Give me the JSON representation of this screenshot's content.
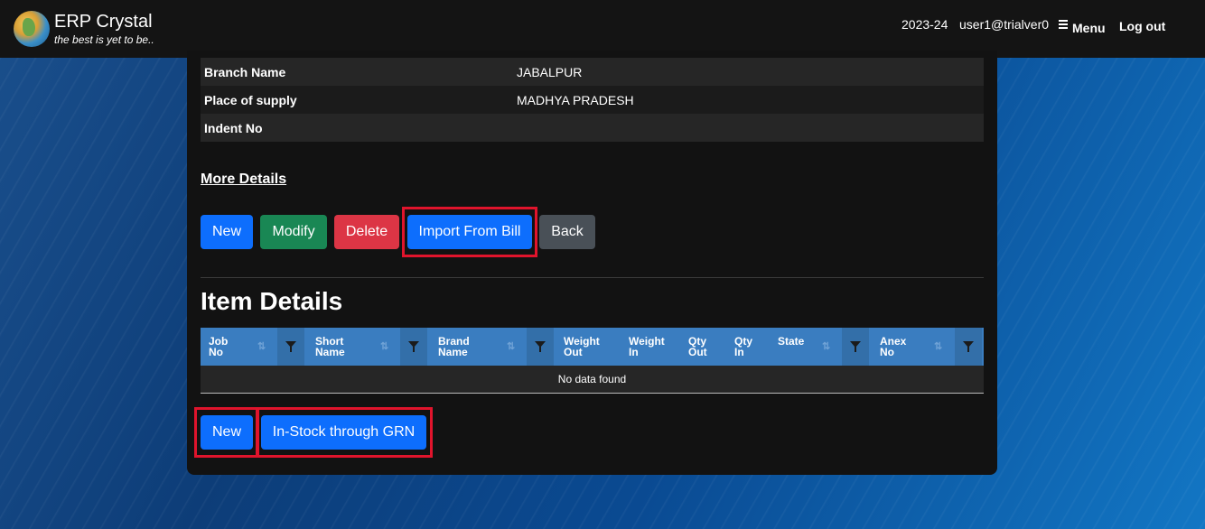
{
  "app": {
    "title": "ERP Crystal",
    "tagline": "the best is yet to be..",
    "year": "2023-24",
    "user": "user1@trialver0",
    "menu_label": "Menu",
    "logout_label": "Log out"
  },
  "info_rows": [
    {
      "label": "Branch Name",
      "value": "JABALPUR"
    },
    {
      "label": "Place of supply",
      "value": "MADHYA PRADESH"
    },
    {
      "label": "Indent No",
      "value": ""
    }
  ],
  "more_details_label": "More Details",
  "actions": {
    "new": "New",
    "modify": "Modify",
    "delete": "Delete",
    "import": "Import From Bill",
    "back": "Back"
  },
  "item_details": {
    "title": "Item Details",
    "columns": [
      {
        "line1": "Job",
        "line2": "No"
      },
      {
        "line1": "Short",
        "line2": "Name"
      },
      {
        "line1": "Brand",
        "line2": "Name"
      },
      {
        "line1": "Weight",
        "line2": "Out"
      },
      {
        "line1": "Weight",
        "line2": "In"
      },
      {
        "line1": "Qty",
        "line2": "Out"
      },
      {
        "line1": "Qty",
        "line2": "In"
      },
      {
        "line1": "",
        "line2": "State"
      },
      {
        "line1": "Anex",
        "line2": "No"
      }
    ],
    "empty_text": "No data found",
    "new_label": "New",
    "instock_label": "In-Stock through GRN"
  },
  "colors": {
    "primary": "#0d6efd",
    "success": "#198754",
    "danger": "#dc3545",
    "secondary": "#495057",
    "highlight": "#e0142c",
    "grid_header": "#3a7dc0"
  }
}
